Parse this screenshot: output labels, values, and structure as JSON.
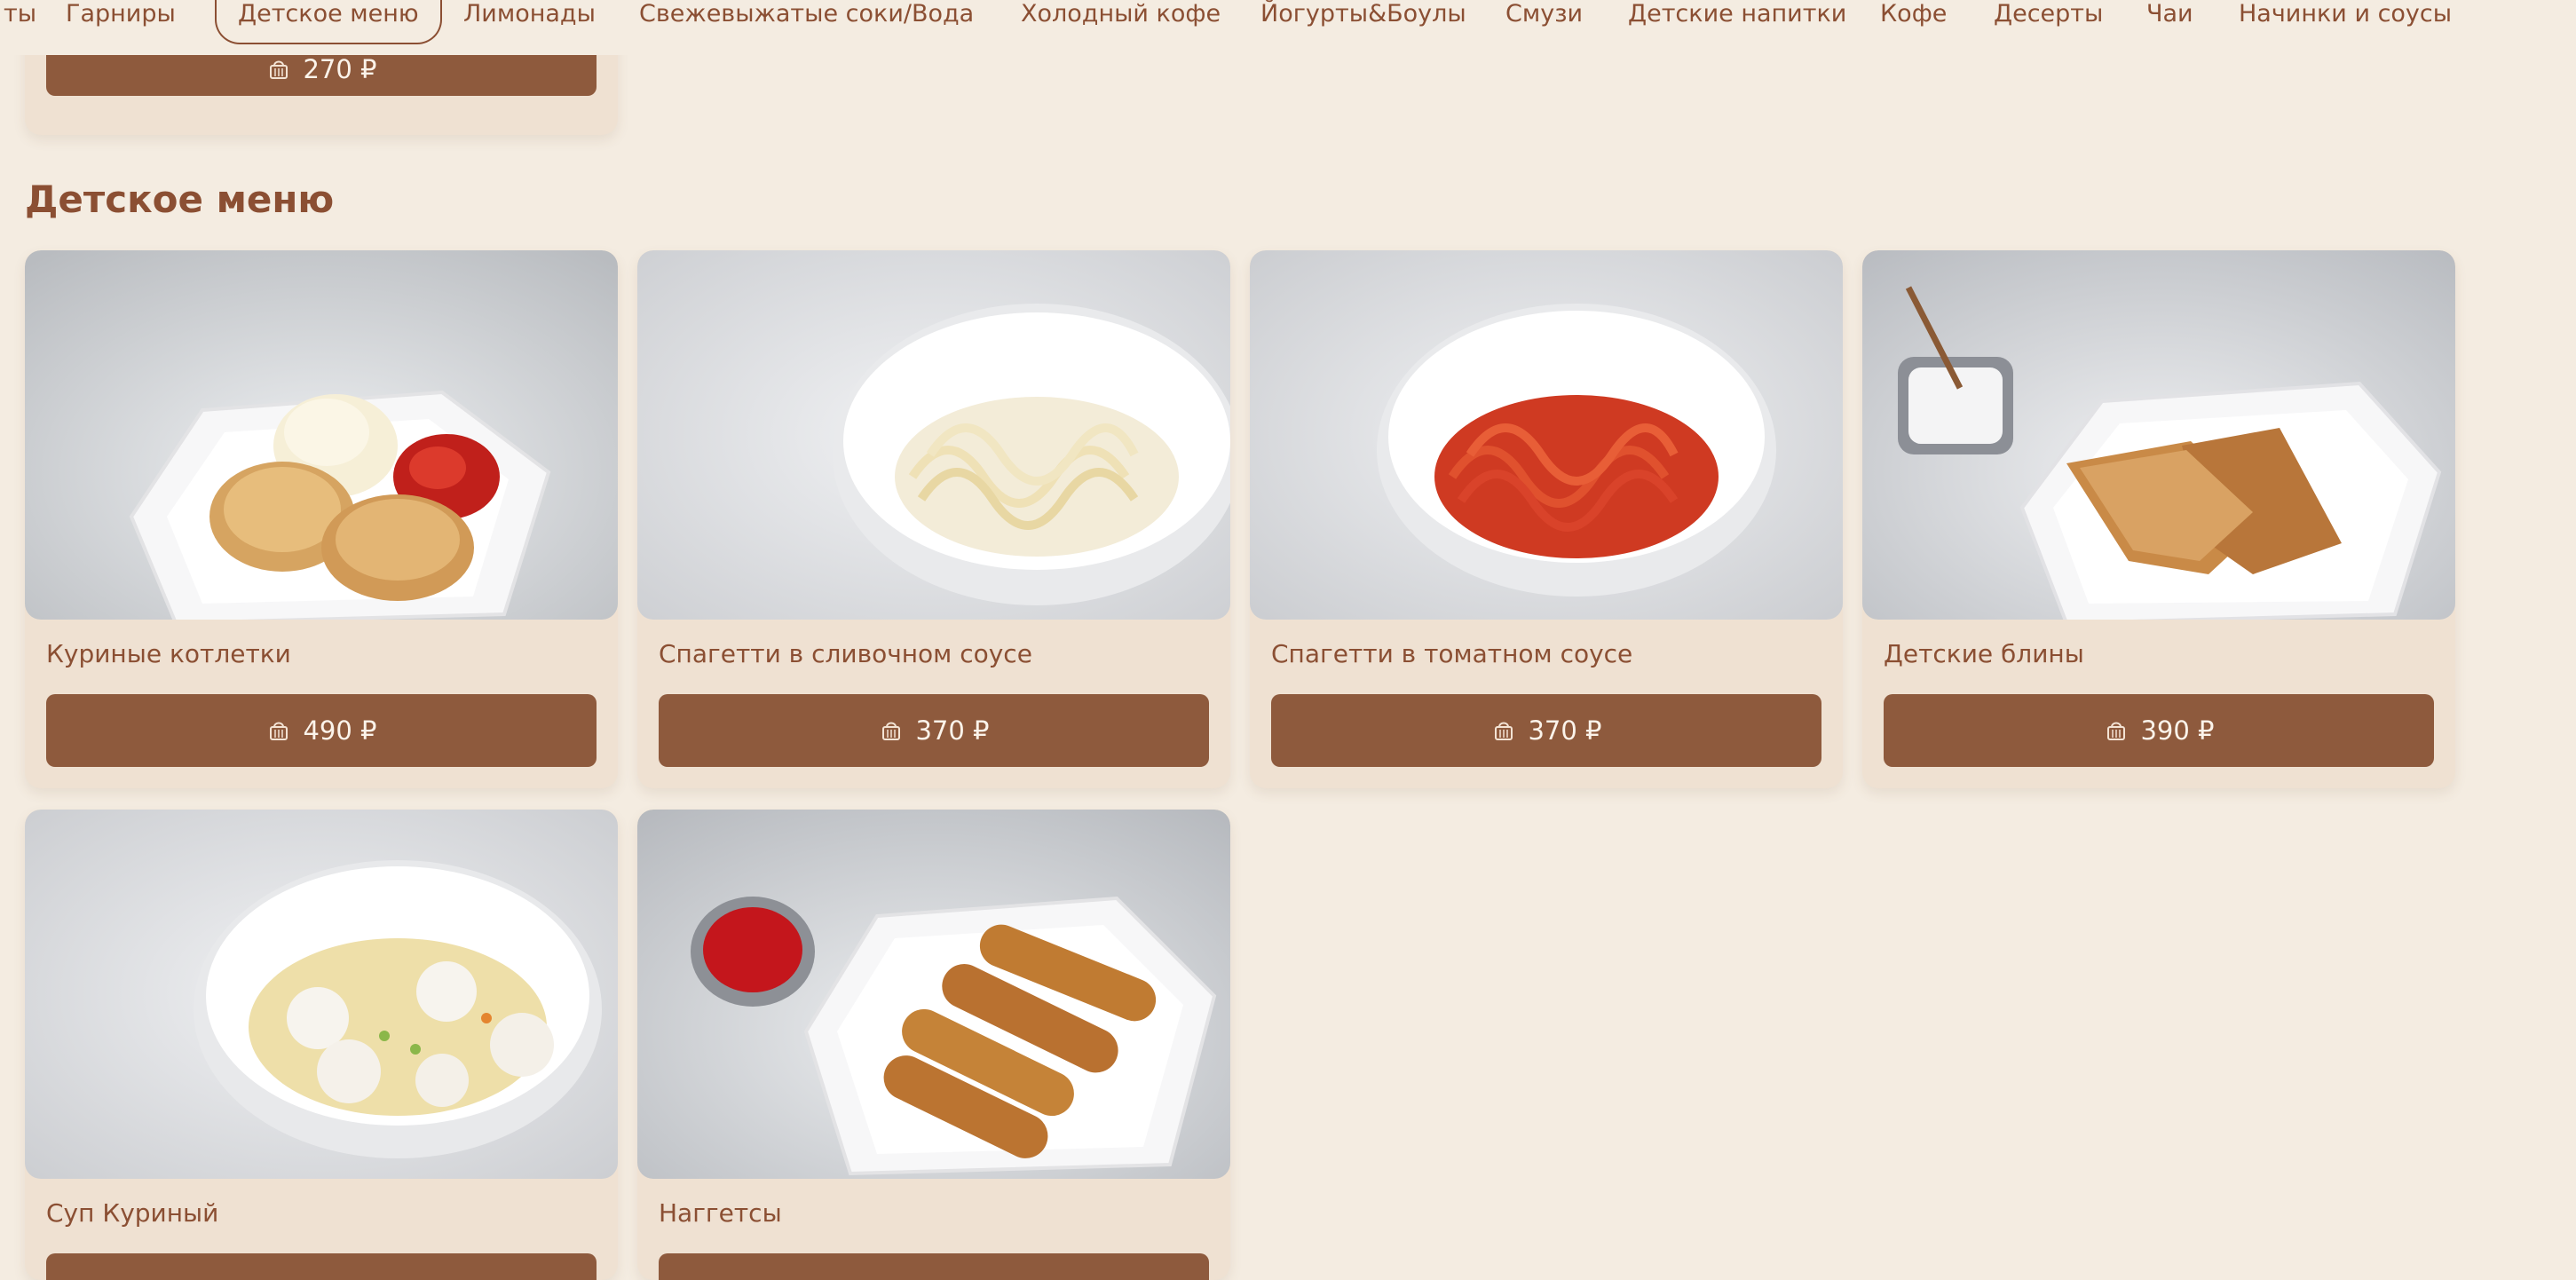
{
  "nav": {
    "items": [
      "ты",
      "Гарниры",
      "Детское меню",
      "Лимонады",
      "Свежевыжатые соки/Вода",
      "Холодный кофе",
      "Йогурты&Боулы",
      "Смузи",
      "Детские напитки",
      "Кофе",
      "Десерты",
      "Чаи",
      "Начинки и соусы"
    ],
    "active": "Детское меню"
  },
  "partial_card": {
    "price": "270 ₽"
  },
  "section": {
    "title": "Детское меню",
    "items": [
      {
        "title": "Куриные котлетки",
        "price": "490 ₽",
        "image_icon": "chicken-cutlets-plate"
      },
      {
        "title": "Спагетти в сливочном соусе",
        "price": "370 ₽",
        "image_icon": "spaghetti-cream-bowl"
      },
      {
        "title": "Спагетти в томатном соусе",
        "price": "370 ₽",
        "image_icon": "spaghetti-tomato-bowl"
      },
      {
        "title": "Детские блины",
        "price": "390 ₽",
        "image_icon": "pancakes-plate"
      },
      {
        "title": "Суп Куриный",
        "price": "",
        "image_icon": "chicken-soup-bowl"
      },
      {
        "title": "Наггетсы",
        "price": "",
        "image_icon": "nuggets-plate"
      }
    ]
  },
  "icons": {
    "price_button": "basket-icon"
  },
  "colors": {
    "background": "#f4ece1",
    "card": "#efe1d2",
    "accent": "#8e5a3d",
    "text": "#8b4f33",
    "button_text": "#fbf3ea"
  }
}
